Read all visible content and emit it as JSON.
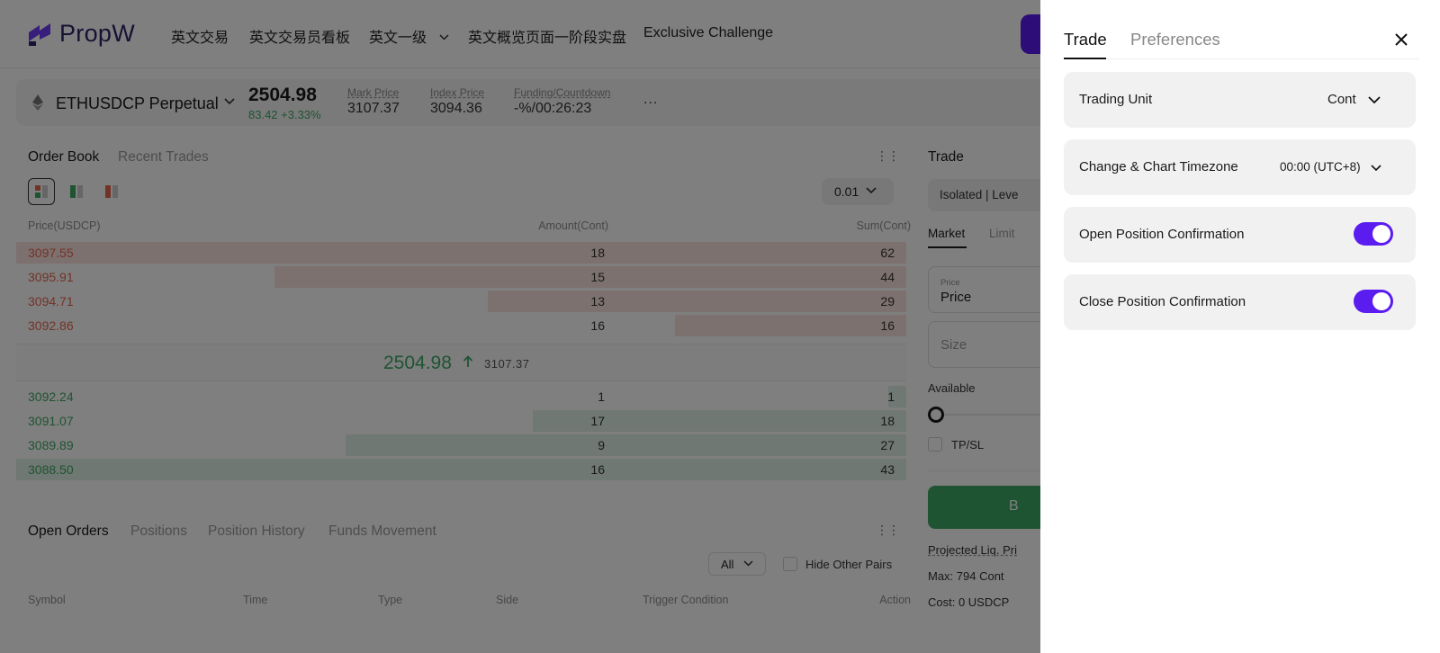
{
  "brand": {
    "name": "PropW"
  },
  "nav": {
    "items": [
      "英文交易",
      "英文交易员看板",
      "英文一级",
      "英文概览页面一阶段实盘",
      "Exclusive Challenge"
    ]
  },
  "ticker": {
    "symbol": "ETHUSDCP Perpetual",
    "last_price": "2504.98",
    "change": "83.42 +3.33%",
    "mark_price_label": "Mark Price",
    "mark_price": "3107.37",
    "index_price_label": "Index Price",
    "index_price": "3094.36",
    "funding_label": "Funding/Countdown",
    "funding": "-%/00:26:23",
    "more": "..."
  },
  "orderbook": {
    "tabs": [
      "Order Book",
      "Recent Trades"
    ],
    "precision": "0.01",
    "columns": [
      "Price(USDCP)",
      "Amount(Cont)",
      "Sum(Cont)"
    ],
    "asks": [
      {
        "price": "3097.55",
        "amount": "18",
        "sum": "62",
        "depth": 1.0
      },
      {
        "price": "3095.91",
        "amount": "15",
        "sum": "44",
        "depth": 0.71
      },
      {
        "price": "3094.71",
        "amount": "13",
        "sum": "29",
        "depth": 0.47
      },
      {
        "price": "3092.86",
        "amount": "16",
        "sum": "16",
        "depth": 0.26
      }
    ],
    "mid": {
      "price": "2504.98",
      "mark": "3107.37"
    },
    "bids": [
      {
        "price": "3092.24",
        "amount": "1",
        "sum": "1",
        "depth": 0.02
      },
      {
        "price": "3091.07",
        "amount": "17",
        "sum": "18",
        "depth": 0.42
      },
      {
        "price": "3089.89",
        "amount": "9",
        "sum": "27",
        "depth": 0.63
      },
      {
        "price": "3088.50",
        "amount": "16",
        "sum": "43",
        "depth": 1.0
      }
    ]
  },
  "orders": {
    "tabs": [
      "Open Orders",
      "Positions",
      "Position History",
      "Funds Movement"
    ],
    "filter": "All",
    "hide_other_pairs": "Hide Other Pairs",
    "columns": [
      "Symbol",
      "Time",
      "Type",
      "Side",
      "Trigger Condition",
      "Action"
    ]
  },
  "trade": {
    "title": "Trade",
    "margin_mode": "Isolated | Leve",
    "order_types": [
      "Market",
      "Limit"
    ],
    "price_small": "Price",
    "price_value": "Price",
    "size_placeholder": "Size",
    "available_label": "Available",
    "tpsl_label": "TP/SL",
    "buy_label": "B",
    "projected_liq": "Projected Liq. Pri",
    "max": "Max: 794 Cont",
    "cost": "Cost: 0 USDCP"
  },
  "drawer": {
    "tabs": [
      "Trade",
      "Preferences"
    ],
    "settings": {
      "trading_unit": {
        "label": "Trading Unit",
        "value": "Cont"
      },
      "timezone": {
        "label": "Change & Chart Timezone",
        "value": "00:00 (UTC+8)"
      },
      "open_confirm": {
        "label": "Open Position Confirmation",
        "on": true
      },
      "close_confirm": {
        "label": "Close Position Confirmation",
        "on": true
      }
    }
  },
  "colors": {
    "accent": "#5b1cf0",
    "buy": "#3fa864",
    "sell": "#e4664f",
    "ask_depth": "#fbe3df",
    "bid_depth": "#dff1e4"
  }
}
